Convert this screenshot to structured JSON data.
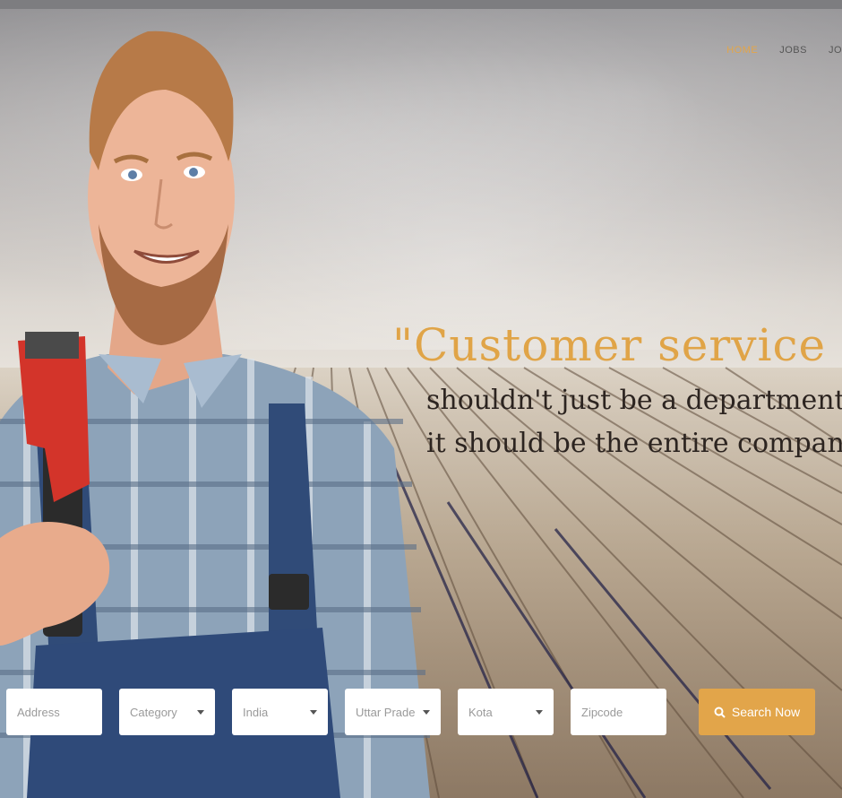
{
  "nav": {
    "items": [
      {
        "label": "HOME",
        "active": true
      },
      {
        "label": "JOBS",
        "active": false
      },
      {
        "label": "JO",
        "active": false
      }
    ],
    "accent_color": "#e2a54a"
  },
  "hero": {
    "quote_line1": "\"Customer service",
    "quote_line2": "shouldn't just be a department,",
    "quote_line3": "it should be the entire company.\""
  },
  "search": {
    "address_placeholder": "Address",
    "category_label": "Category",
    "country_label": "India",
    "state_label": "Uttar Prade",
    "city_label": "Kota",
    "zipcode_placeholder": "Zipcode",
    "button_label": "Search Now",
    "button_icon": "search-icon"
  }
}
